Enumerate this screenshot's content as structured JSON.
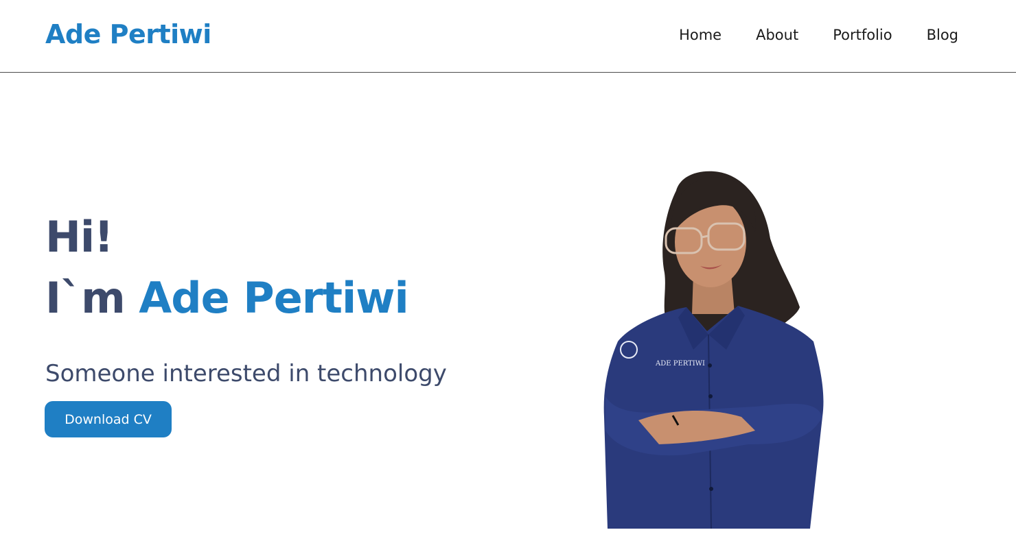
{
  "header": {
    "brand": "Ade Pertiwi",
    "nav": [
      {
        "label": "Home"
      },
      {
        "label": "About"
      },
      {
        "label": "Portfolio"
      },
      {
        "label": "Blog"
      }
    ]
  },
  "hero": {
    "greeting": "Hi!",
    "intro_prefix": "I`m ",
    "name": "Ade Pertiwi",
    "tagline": "Someone interested in technology",
    "cta_label": "Download CV",
    "portrait_shirt_text": "ADE PERTIWI"
  },
  "colors": {
    "accent": "#1f7fc4",
    "heading": "#3d4a6b",
    "shirt": "#2a3a7c"
  }
}
